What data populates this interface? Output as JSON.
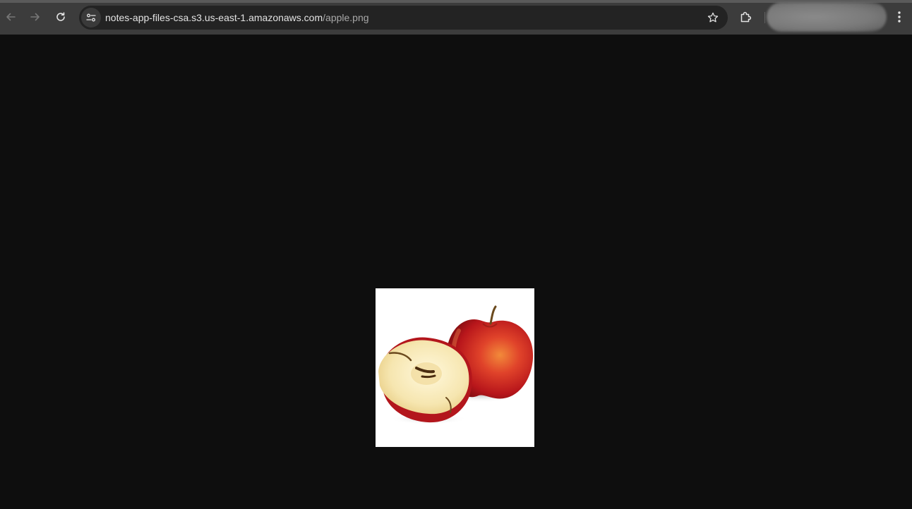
{
  "browser": {
    "url_host": "notes-app-files-csa.s3.us-east-1.amazonaws.com",
    "url_path": "/apple.png",
    "icons": {
      "back": "arrow-left-icon",
      "forward": "arrow-right-icon",
      "reload": "reload-icon",
      "site_info": "tune-icon",
      "bookmark": "star-icon",
      "extensions": "puzzle-icon",
      "menu": "kebab-menu-icon"
    },
    "colors": {
      "toolbar": "#3c3c3c",
      "omnibox": "#232323",
      "page_background": "#0e0e0e"
    }
  },
  "viewer": {
    "image_alt": "apple.png",
    "image_background": "#ffffff"
  }
}
